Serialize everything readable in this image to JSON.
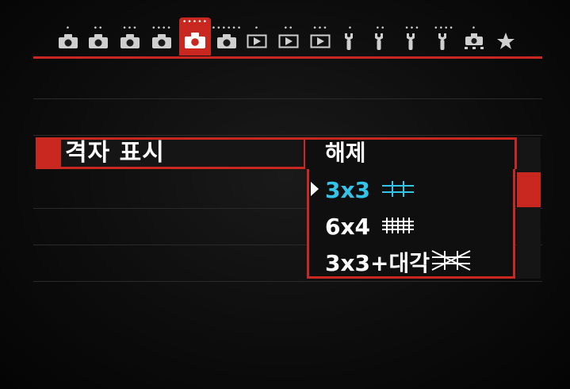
{
  "tabs": [
    {
      "icon": "camera-icon",
      "dots": "•"
    },
    {
      "icon": "camera-icon",
      "dots": "••"
    },
    {
      "icon": "camera-icon",
      "dots": "•••"
    },
    {
      "icon": "camera-icon",
      "dots": "••••"
    },
    {
      "icon": "camera-icon",
      "dots": "•••••"
    },
    {
      "icon": "camera-icon",
      "dots": "••••••"
    },
    {
      "icon": "playback-icon",
      "dots": "•"
    },
    {
      "icon": "playback-icon",
      "dots": "••"
    },
    {
      "icon": "playback-icon",
      "dots": "•••"
    },
    {
      "icon": "wrench-icon",
      "dots": "•"
    },
    {
      "icon": "wrench-icon",
      "dots": "••"
    },
    {
      "icon": "wrench-icon",
      "dots": "•••"
    },
    {
      "icon": "wrench-icon",
      "dots": "••••"
    },
    {
      "icon": "custom-camera-icon",
      "dots": "•"
    },
    {
      "icon": "star-icon",
      "dots": ""
    }
  ],
  "active_tab_index": 4,
  "setting": {
    "label": "격자 표시",
    "current_value": "해제"
  },
  "options": [
    {
      "label": "3x3",
      "grid": "3x3",
      "selected": true
    },
    {
      "label": "6x4",
      "grid": "6x4",
      "selected": false
    },
    {
      "label": "3x3+대각",
      "grid": "3x3-diagonal",
      "selected": false
    }
  ],
  "colors": {
    "accent": "#c8281f",
    "selected": "#33c4ea",
    "text": "#ffffff"
  }
}
